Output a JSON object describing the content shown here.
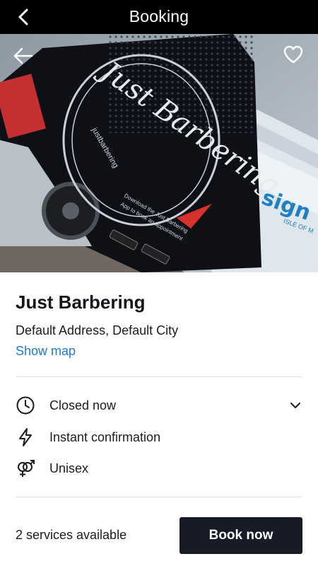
{
  "header": {
    "title": "Booking",
    "back_icon": "arrow-left-icon"
  },
  "hero": {
    "back_icon": "arrow-left-icon",
    "favorite_icon": "heart-outline-icon",
    "photo": {
      "logo_lettering": "Just Barbering",
      "social_handle": "justbarbering",
      "app_text_line1": "Download the Just Barbering",
      "app_text_line2": "App to book an appointment",
      "store_badges": [
        "Google Play",
        "App Store"
      ],
      "sign_text": "sign",
      "sign_subtext": "ISLE OF M"
    }
  },
  "shop": {
    "name": "Just Barbering",
    "address": "Default Address, Default City",
    "show_map_label": "Show map"
  },
  "details": [
    {
      "icon": "clock-icon",
      "label": "Closed now",
      "expandable": true
    },
    {
      "icon": "lightning-icon",
      "label": "Instant confirmation"
    },
    {
      "icon": "gender-icon",
      "label": "Unisex"
    }
  ],
  "footer": {
    "services_text": "2 services available",
    "book_label": "Book now"
  },
  "colors": {
    "accent_link": "#1f7ad4",
    "button_bg": "#171b26",
    "header_bg": "#000000"
  }
}
